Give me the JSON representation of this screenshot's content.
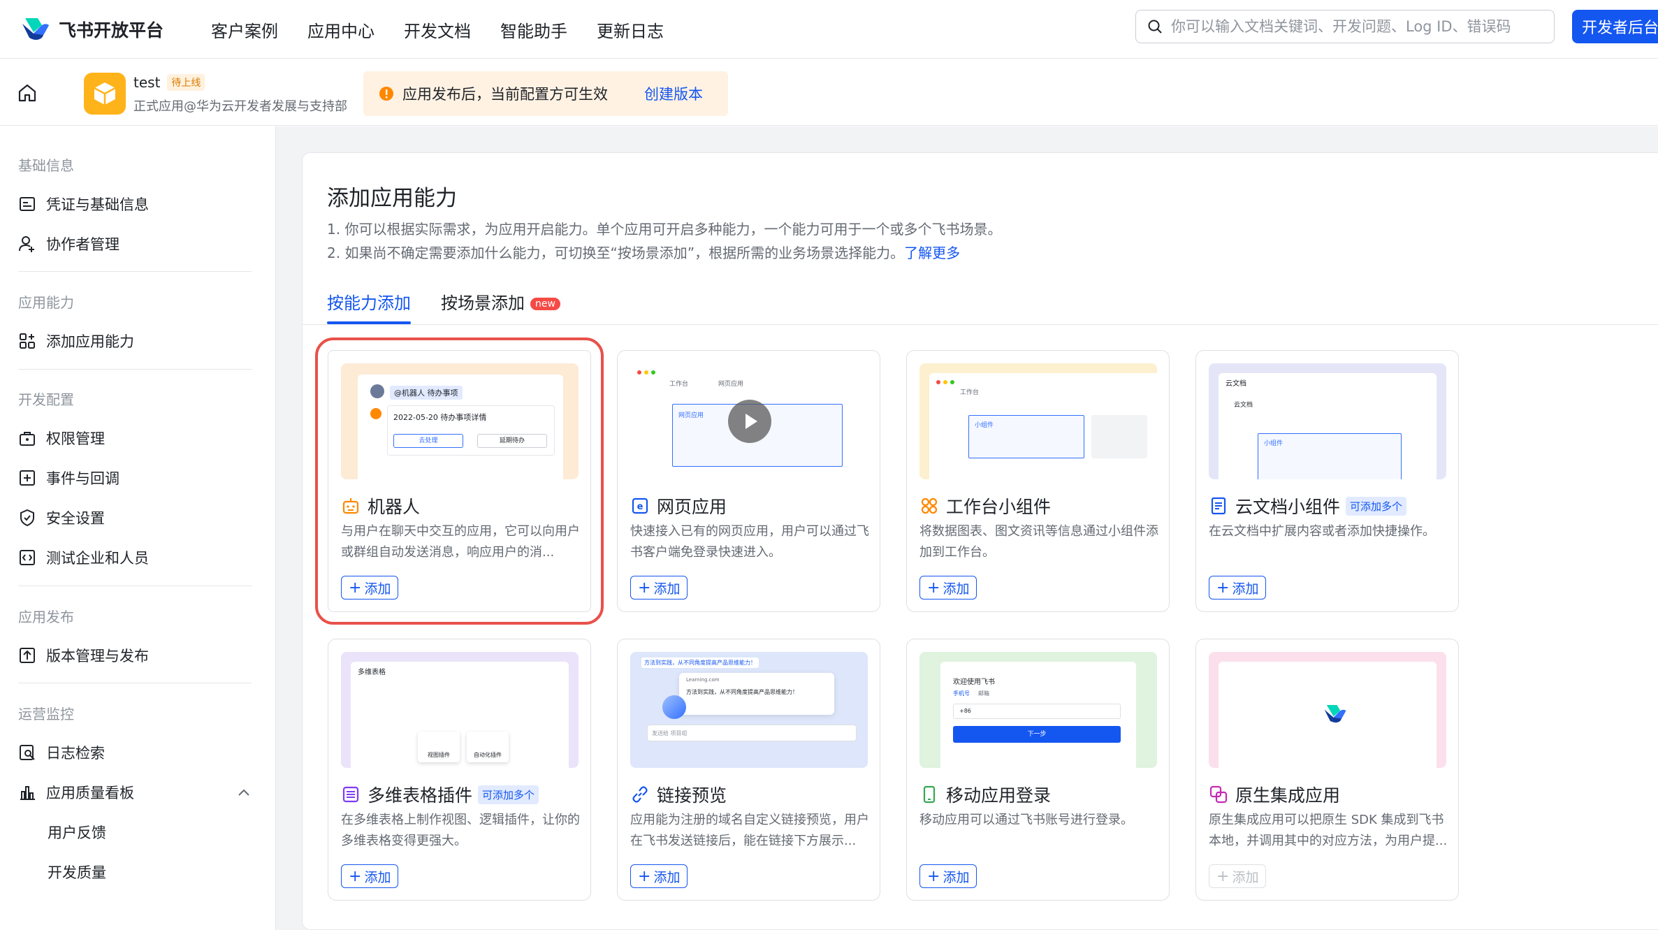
{
  "header": {
    "brand": "飞书开放平台",
    "nav": [
      "客户案例",
      "应用中心",
      "开发文档",
      "智能助手",
      "更新日志"
    ],
    "search_placeholder": "你可以输入文档关键词、开发问题、Log ID、错误码",
    "dev_console": "开发者后台"
  },
  "app": {
    "name": "test",
    "status": "待上线",
    "desc": "正式应用@华为云开发者发展与支持部",
    "notice": "应用发布后，当前配置方可生效",
    "notice_link": "创建版本"
  },
  "sidebar": {
    "sections": [
      {
        "title": "基础信息",
        "items": [
          {
            "label": "凭证与基础信息",
            "icon": "credential-icon"
          },
          {
            "label": "协作者管理",
            "icon": "user-add-icon"
          }
        ]
      },
      {
        "title": "应用能力",
        "items": [
          {
            "label": "添加应用能力",
            "icon": "apps-add-icon"
          }
        ]
      },
      {
        "title": "开发配置",
        "items": [
          {
            "label": "权限管理",
            "icon": "permission-icon"
          },
          {
            "label": "事件与回调",
            "icon": "event-icon"
          },
          {
            "label": "安全设置",
            "icon": "shield-icon"
          },
          {
            "label": "测试企业和人员",
            "icon": "test-icon"
          }
        ]
      },
      {
        "title": "应用发布",
        "items": [
          {
            "label": "版本管理与发布",
            "icon": "upload-icon"
          }
        ]
      },
      {
        "title": "运营监控",
        "items": [
          {
            "label": "日志检索",
            "icon": "log-search-icon"
          },
          {
            "label": "应用质量看板",
            "icon": "bar-chart-icon"
          },
          {
            "label": "用户反馈"
          },
          {
            "label": "开发质量"
          }
        ]
      }
    ]
  },
  "panel": {
    "title": "添加应用能力",
    "desc1": "1. 你可以根据实际需求，为应用开启能力。单个应用可开启多种能力，一个能力可用于一个或多个飞书场景。",
    "desc2": "2. 如果尚不确定需要添加什么能力，可切换至“按场景添加”，根据所需的业务场景选择能力。",
    "learn_more": "了解更多",
    "tabs": [
      "按能力添加",
      "按场景添加"
    ],
    "new_badge": "new",
    "add_label": "添加",
    "multi_tag": "可添加多个",
    "cards": [
      {
        "title": "机器人",
        "desc": "与用户在聊天中交互的应用，它可以向用户或群组自动发送消息，响应用户的消...",
        "icon": "robot-icon",
        "highlighted": true,
        "enabled": true,
        "pv_bg": "#fdebd6"
      },
      {
        "title": "网页应用",
        "desc": "快速接入已有的网页应用，用户可以通过飞书客户端免登录快速进入。",
        "icon": "web-app-icon",
        "enabled": true,
        "pv_bg": "#dfe6fb"
      },
      {
        "title": "工作台小组件",
        "desc": "将数据图表、图文资讯等信息通过小组件添加到工作台。",
        "icon": "widget-icon",
        "enabled": true,
        "pv_bg": "#fcf0cf"
      },
      {
        "title": "云文档小组件",
        "desc": "在云文档中扩展内容或者添加快捷操作。",
        "icon": "doc-icon",
        "multi": true,
        "enabled": true,
        "pv_bg": "#e4e6f8"
      },
      {
        "title": "多维表格插件",
        "desc": "在多维表格上制作视图、逻辑插件，让你的多维表格变得更强大。",
        "icon": "base-icon",
        "multi": true,
        "enabled": true,
        "pv_bg": "#ebe3f9"
      },
      {
        "title": "链接预览",
        "desc": "应用能为注册的域名自定义链接预览，用户在飞书发送链接后，能在链接下方展示...",
        "icon": "link-icon",
        "enabled": true,
        "pv_bg": "#dde6fa"
      },
      {
        "title": "移动应用登录",
        "desc": "移动应用可以通过飞书账号进行登录。",
        "icon": "mobile-icon",
        "enabled": true,
        "pv_bg": "#dff3df"
      },
      {
        "title": "原生集成应用",
        "desc": "原生集成应用可以把原生 SDK 集成到飞书本地，并调用其中的对应方法，为用户提...",
        "icon": "native-icon",
        "enabled": false,
        "pv_bg": "#fbe0ec"
      }
    ]
  },
  "previews": {
    "robot_tag": "@机器人 待办事项",
    "robot_line": "2022-05-20 待办事项详情",
    "robot_btn1": "去处理",
    "robot_btn2": "延期待办",
    "web_tab1": "工作台",
    "web_tab2": "网页应用",
    "web_label": "网页应用",
    "widget_tab": "工作台",
    "widget_label": "小组件",
    "doc_title": "云文档",
    "doc_sub": "云文档",
    "doc_widget": "小组件",
    "base_title": "多维表格",
    "base_p1": "视图插件",
    "base_p2": "自动化插件",
    "link_msg": "方法到实践，从不同角度提高产品思维能力！",
    "link_domain": "Learning.com",
    "link_body": "方法到实践，从不同角度提高产品思维能力！",
    "link_input": "发送给 项目组",
    "mobile_welcome": "欢迎使用飞书",
    "mobile_tab1": "手机号",
    "mobile_tab2": "邮箱",
    "mobile_code": "+86",
    "mobile_next": "下一步"
  }
}
